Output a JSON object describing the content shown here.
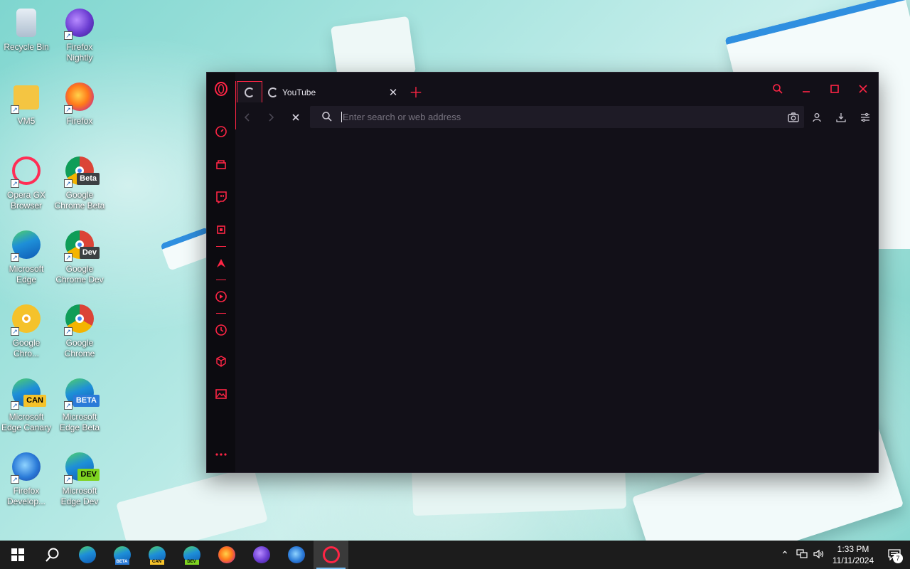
{
  "desktop": {
    "icons": [
      {
        "label": "Recycle Bin"
      },
      {
        "label": "Firefox Nightly"
      },
      {
        "label": "VM5"
      },
      {
        "label": "Firefox"
      },
      {
        "label": "Opera GX Browser"
      },
      {
        "label": "Google Chrome Beta",
        "badge": "Beta"
      },
      {
        "label": "Microsoft Edge"
      },
      {
        "label": "Google Chrome Dev",
        "badge": "Dev"
      },
      {
        "label": "Google Chro..."
      },
      {
        "label": "Google Chrome"
      },
      {
        "label": "Microsoft Edge Canary",
        "badge": "CAN"
      },
      {
        "label": "Microsoft Edge Beta",
        "badge": "BETA"
      },
      {
        "label": "Firefox Develop..."
      },
      {
        "label": "Microsoft Edge Dev",
        "badge": "DEV"
      }
    ]
  },
  "browser": {
    "tab": {
      "title": "YouTube"
    },
    "address": {
      "placeholder": "Enter search or web address",
      "value": ""
    },
    "accent": "#ff2545"
  },
  "taskbar": {
    "mini_labels": {
      "edge_beta": "BETA",
      "edge_canary": "CAN",
      "edge_dev": "DEV"
    },
    "clock": {
      "time": "1:33 PM",
      "date": "11/11/2024"
    },
    "notifications": "7"
  }
}
